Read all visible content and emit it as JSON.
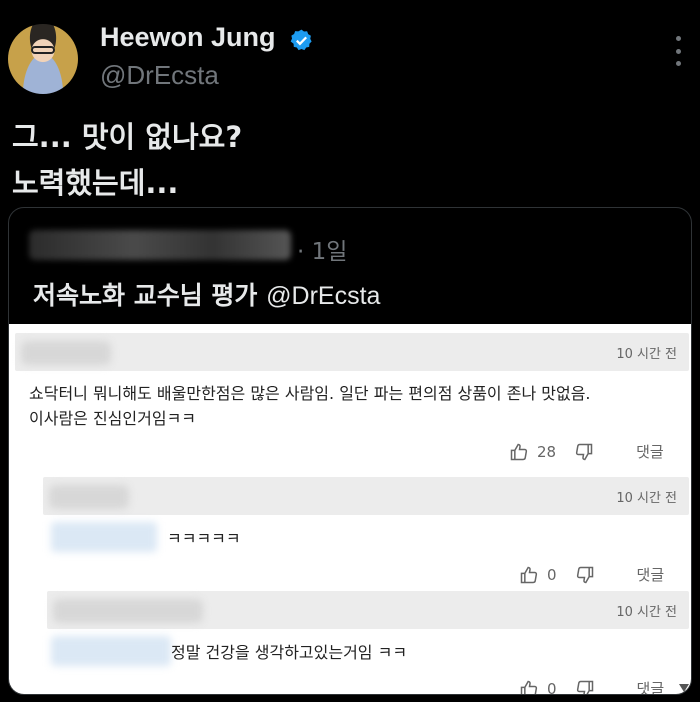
{
  "author": {
    "name": "Heewon Jung",
    "handle": "@DrEcsta",
    "icons": {
      "verified": "verified-badge-icon",
      "more": "more-options-icon"
    },
    "verified_color": "#1d9bf0"
  },
  "tweet": {
    "line1": "그... 맛이 없나요?",
    "line2": "노력했는데..."
  },
  "quote": {
    "date": "· 1일",
    "title": "저속노화 교수님 평가",
    "mention": "@DrEcsta"
  },
  "comments": [
    {
      "time": "10 시간 전",
      "text_line1": "쇼닥터니 뭐니해도 배울만한점은 많은 사람임. 일단 파는 편의점 상품이 존나 맛없음.",
      "text_line2": "이사람은 진심인거임ㅋㅋ",
      "likes": "28",
      "reply": "댓글"
    },
    {
      "time": "10 시간 전",
      "text_line1": "ㅋㅋㅋㅋㅋ",
      "likes": "0",
      "reply": "댓글"
    },
    {
      "time": "10 시간 전",
      "text_line1": "정말 건강을 생각하고있는거임 ㅋㅋ",
      "likes": "0",
      "reply": "댓글"
    }
  ]
}
